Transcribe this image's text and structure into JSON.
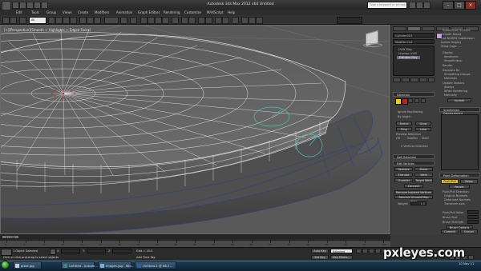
{
  "window": {
    "title": "Autodesk 3ds Max 2012 x64    Untitled",
    "search_placeholder": "Type a keyword or phrase"
  },
  "menu": [
    "Edit",
    "Tools",
    "Group",
    "Views",
    "Create",
    "Modifiers",
    "Animation",
    "Graph Editors",
    "Rendering",
    "Customize",
    "MAXScript",
    "Help"
  ],
  "toolbar": {
    "selection_filter": "All",
    "named_selection": ""
  },
  "viewport": {
    "label": "[+][Perspective][Smooth + Highlights + Edged Faces]"
  },
  "command_panel": {
    "object_name": "Cylinder001",
    "modifier_list_label": "Modifier List",
    "stack": [
      "UVW Map",
      "Unwrap UVW",
      "Editable Poly"
    ],
    "stack_selected": "Editable Poly",
    "sections": {
      "selection": "Selection",
      "ignore_backfacing": "Ignore Backfacing",
      "by_angle": "By Angle:",
      "shrink": "Shrink",
      "grow": "Grow",
      "ring": "Ring",
      "loop": "Loop",
      "preview_selection": "Preview Selection",
      "preview_off": "Off",
      "preview_subobj": "SubObj",
      "preview_multi": "Multi",
      "vertices_selected": "0 Vertices Selected",
      "soft_selection": "Soft Selection",
      "edit_vertices": "Edit Vertices",
      "remove": "Remove",
      "break": "Break",
      "extrude": "Extrude",
      "weld": "Weld",
      "chamfer": "Chamfer",
      "target_weld": "Target Weld",
      "connect": "Connect",
      "remove_isolated": "Remove Isolated Vertices",
      "remove_unused": "Remove Unused Map Verts",
      "weight": "Weight:",
      "weight_value": "1.0",
      "subdivision": "Subdivision Surface",
      "smooth_result": "Smooth Result",
      "use_nurms": "Use NURMS Subdivision",
      "isoline": "Isoline Display",
      "show_cage": "Show Cage......",
      "display": "Display",
      "iterations": "Iterations:",
      "smoothness": "Smoothness:",
      "render": "Render",
      "separate_by": "Separate By",
      "smoothing_groups": "Smoothing Groups",
      "materials": "Materials",
      "update_options": "Update Options",
      "always": "Always",
      "when_rendering": "When Rendering",
      "manually": "Manually",
      "update": "Update",
      "subdivision_displacement": "Subdivision Displacement",
      "paint_deformation": "Paint Deformation",
      "push_pull": "Push/Pull",
      "relax": "Relax",
      "revert": "Revert",
      "push_pull_direction": "Push/Pull Direction",
      "original_normals": "Original Normals",
      "deformed_normals": "Deformed Normals",
      "transform_axis": "Transform axis",
      "push_pull_value": "Push/Pull Value",
      "brush_size": "Brush Size",
      "brush_strength": "Brush Strength",
      "brush_options": "Brush Options",
      "commit": "Commit",
      "cancel": "Cancel"
    }
  },
  "timeline": {
    "current": "0 / 100",
    "ticks": [
      "0",
      "5",
      "10",
      "15",
      "20",
      "25",
      "30",
      "35",
      "40",
      "45",
      "50",
      "55",
      "60",
      "65",
      "70",
      "75",
      "80",
      "85",
      "90",
      "95",
      "100"
    ]
  },
  "status": {
    "selection": "1 Object Selected",
    "prompt": "Click or click-and-drag to select objects",
    "x_label": "X:",
    "y_label": "Y:",
    "z_label": "Z:",
    "grid": "Grid = 10.0",
    "auto_key": "Auto Key",
    "selected": "Selected",
    "add_time_tag": "Add Time Tag",
    "set_key": "Set Key",
    "key_filters": "Key Filters..."
  },
  "taskbar": {
    "items": [
      "plate.jpg",
      "Untitled - Autode...",
      "Images.jpg - Win...",
      "Untitled-1 @ 66.7..."
    ],
    "clock_time": "",
    "clock_date": "10 Nov 11"
  },
  "watermark": "pxleyes.com",
  "colors": {
    "viewport_bg": "#595959",
    "wire": "#ececec",
    "selection_red": "#d62020",
    "gizmo": "#3ec7b0",
    "blue_wire": "#2a3d8a"
  }
}
